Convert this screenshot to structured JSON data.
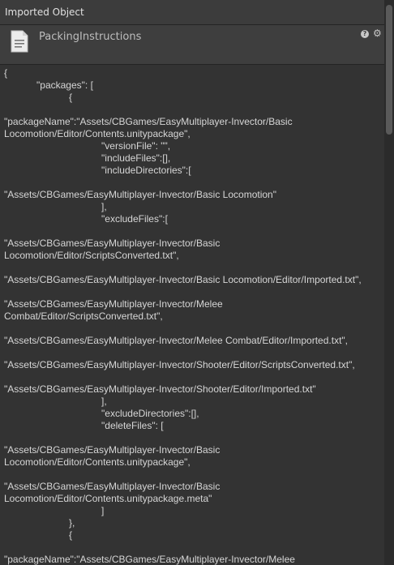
{
  "window": {
    "title": "Imported Object"
  },
  "header": {
    "object_name": "PackingInstructions"
  },
  "icons": {
    "file": "text-file-icon",
    "help": "help-icon",
    "settings": "gear-icon"
  },
  "code_lines": [
    "{",
    "            \"packages\": [",
    "                        {",
    "",
    "\"packageName\":\"Assets/CBGames/EasyMultiplayer-Invector/Basic",
    "Locomotion/Editor/Contents.unitypackage\",",
    "                                    \"versionFile\": \"\",",
    "                                    \"includeFiles\":[],",
    "                                    \"includeDirectories\":[",
    "",
    "\"Assets/CBGames/EasyMultiplayer-Invector/Basic Locomotion\"",
    "                                    ],",
    "                                    \"excludeFiles\":[",
    "",
    "\"Assets/CBGames/EasyMultiplayer-Invector/Basic",
    "Locomotion/Editor/ScriptsConverted.txt\",",
    "",
    "\"Assets/CBGames/EasyMultiplayer-Invector/Basic Locomotion/Editor/Imported.txt\",",
    "",
    "\"Assets/CBGames/EasyMultiplayer-Invector/Melee",
    "Combat/Editor/ScriptsConverted.txt\",",
    "",
    "\"Assets/CBGames/EasyMultiplayer-Invector/Melee Combat/Editor/Imported.txt\",",
    "",
    "\"Assets/CBGames/EasyMultiplayer-Invector/Shooter/Editor/ScriptsConverted.txt\",",
    "",
    "\"Assets/CBGames/EasyMultiplayer-Invector/Shooter/Editor/Imported.txt\"",
    "                                    ],",
    "                                    \"excludeDirectories\":[],",
    "                                    \"deleteFiles\": [",
    "",
    "\"Assets/CBGames/EasyMultiplayer-Invector/Basic",
    "Locomotion/Editor/Contents.unitypackage\",",
    "",
    "\"Assets/CBGames/EasyMultiplayer-Invector/Basic",
    "Locomotion/Editor/Contents.unitypackage.meta\"",
    "                                    ]",
    "                        },",
    "                        {",
    "",
    "\"packageName\":\"Assets/CBGames/EasyMultiplayer-Invector/Melee"
  ]
}
